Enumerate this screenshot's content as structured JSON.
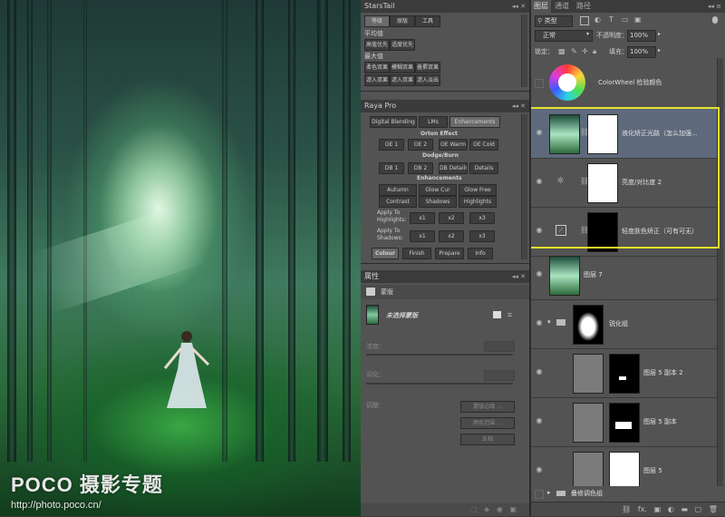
{
  "watermark": {
    "brand": "POCO 摄影专题",
    "url": "http://photo.poco.cn/"
  },
  "starstail": {
    "title": "StarsTail",
    "tabs": [
      "等级",
      "原版",
      "工具"
    ],
    "section1": "平均值",
    "s1_buttons": [
      "高值优先",
      "适度优先"
    ],
    "section2": "最大值",
    "s2_row1": [
      "柔色双果",
      "模糊双果",
      "叠累双果"
    ],
    "s2_row2": [
      "滤入双果",
      "滤入双果",
      "滤入淡出"
    ]
  },
  "raya": {
    "title": "Raya Pro",
    "tabs": [
      "Digital Blending",
      "LMs",
      "Enhancements"
    ],
    "orton_label": "Orton Effect",
    "orton": [
      "OE 1",
      "OE 2",
      "OE Warm",
      "OE Cold"
    ],
    "dodge_label": "Dodge/Burn",
    "dodge": [
      "DB 1",
      "DB 2",
      "DB Details",
      "Details"
    ],
    "enh_label": "Enhancements",
    "enh_row1": [
      "Autumn",
      "Glow Cur",
      "Glow Free"
    ],
    "enh_row2": [
      "Contrast",
      "Shadows",
      "Highlights"
    ],
    "apply_highlights": "Apply To Highlights:",
    "apply_shadows": "Apply To Shadows:",
    "mult": [
      "x1",
      "x2",
      "x3"
    ],
    "footer": [
      "Colour",
      "Finish",
      "Prepare",
      "Info"
    ]
  },
  "properties": {
    "title": "属性",
    "type": "蒙版",
    "mask_name": "未选择蒙版",
    "density_label": "浓度：",
    "feather_label": "羽化：",
    "adjust_label": "调整：",
    "buttons": [
      "蒙版边缘 ...",
      "颜色范围 ...",
      "反相"
    ]
  },
  "layers_panel": {
    "tabs": [
      "图层",
      "通道",
      "路径"
    ],
    "filter_kind": "类型",
    "blend_mode": "正常",
    "opacity_label": "不透明度：",
    "opacity_value": "100%",
    "lock_label": "锁定：",
    "fill_label": "填充：",
    "fill_value": "100%",
    "layers": [
      {
        "name": "ColorWheel 检验颜色"
      },
      {
        "name": "液化矫正光路（怎么加强..."
      },
      {
        "name": "亮度/对比度 2"
      },
      {
        "name": "轻度肤色矫正（可有可无）"
      },
      {
        "name": "图层 7"
      },
      {
        "name": "锐化组"
      },
      {
        "name": "图层 5 副本 2"
      },
      {
        "name": "图层 5 副本"
      },
      {
        "name": "图层 5"
      },
      {
        "name": "叠修调色组"
      }
    ],
    "footer_icons": [
      "link-icon",
      "fx-icon",
      "mask-icon",
      "adjust-icon",
      "folder-icon",
      "new-layer-icon",
      "trash-icon"
    ]
  },
  "colors": {
    "highlight": "#e5e12b",
    "selected_row": "#5e6a7c"
  }
}
